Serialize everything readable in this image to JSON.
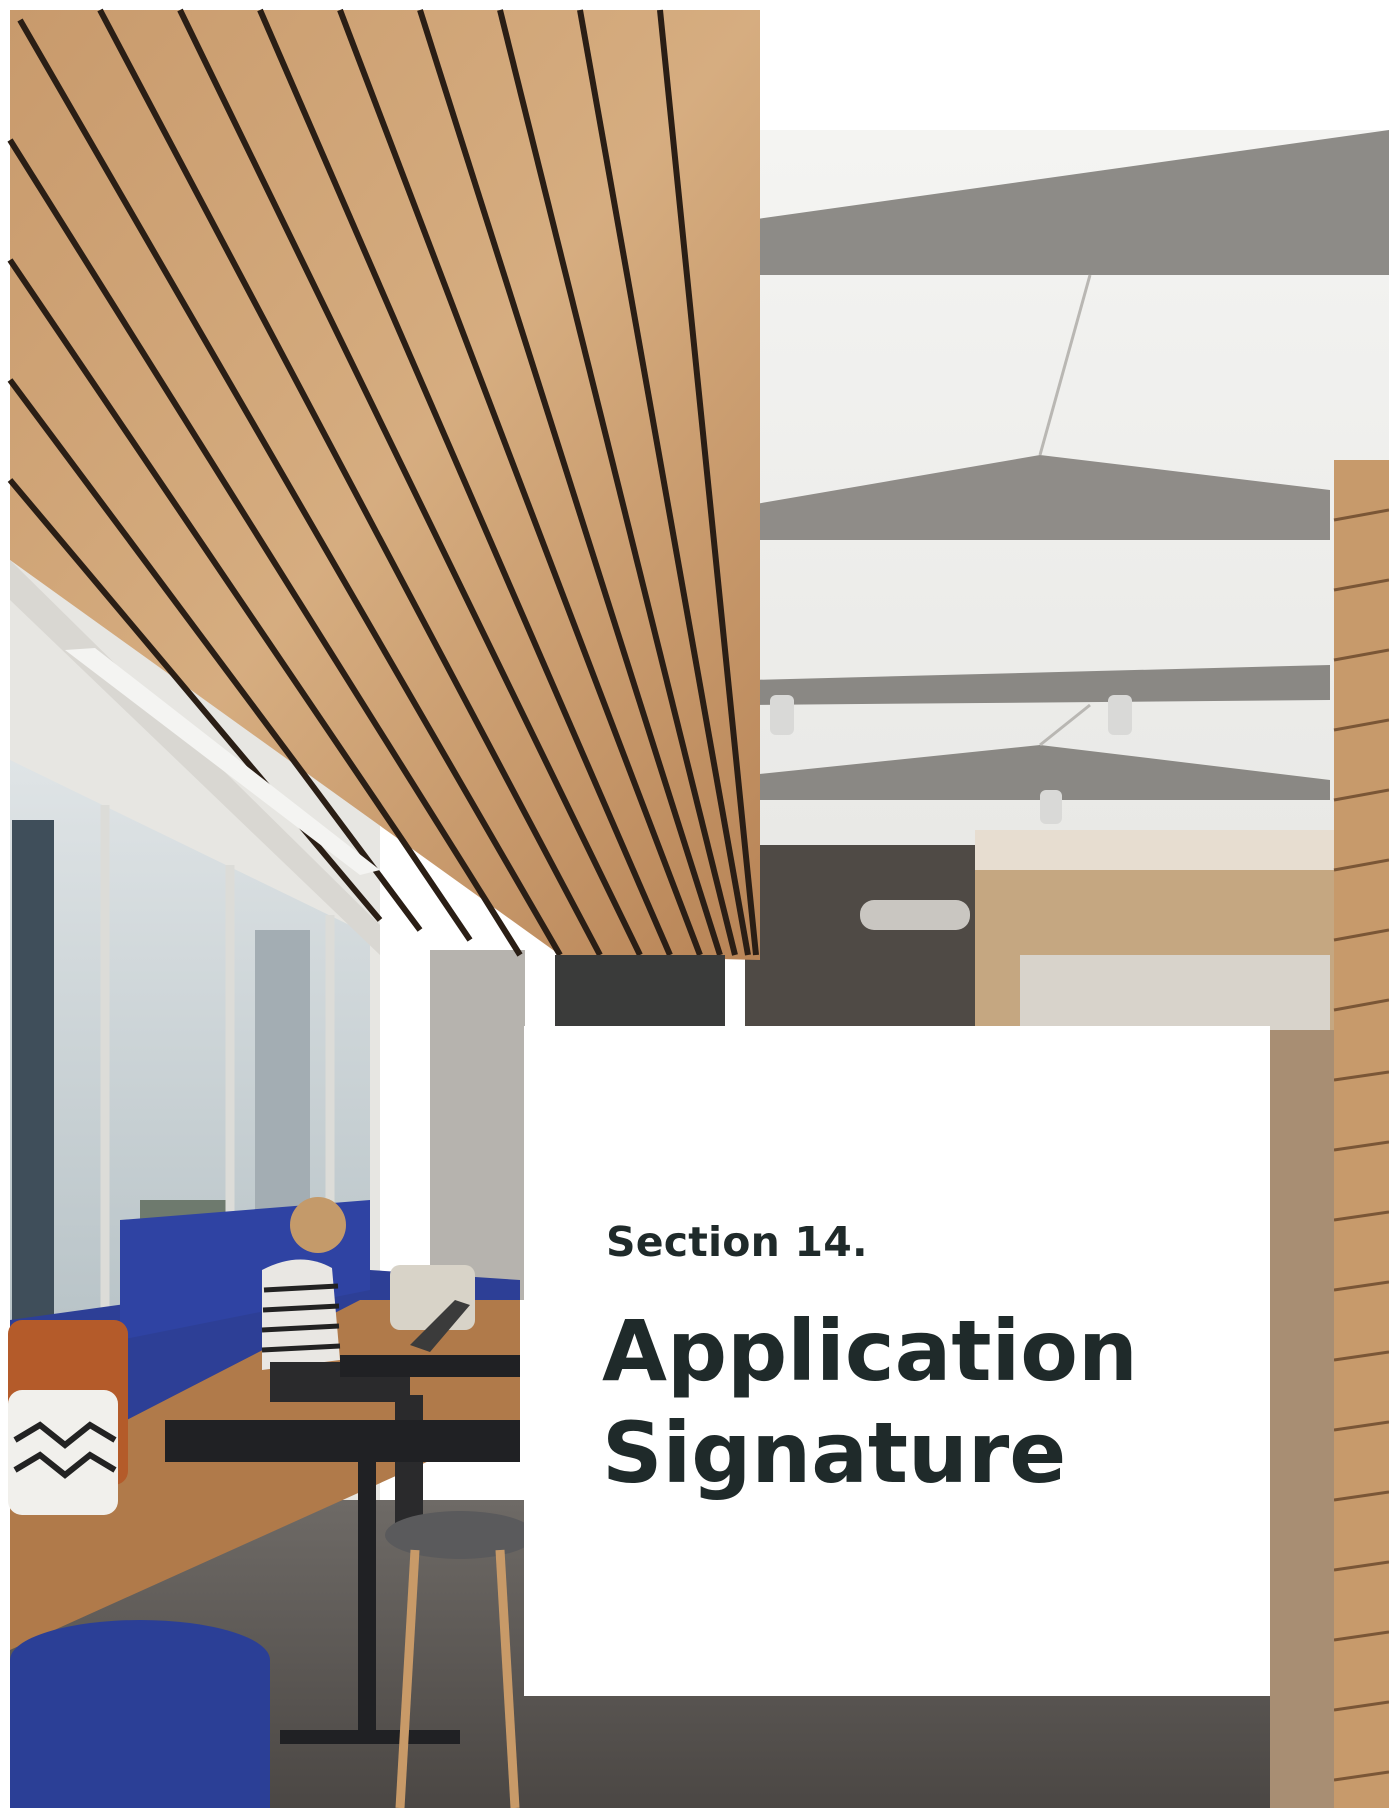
{
  "section": {
    "label": "Section 14.",
    "title_line1": "Application",
    "title_line2": "Signature"
  }
}
